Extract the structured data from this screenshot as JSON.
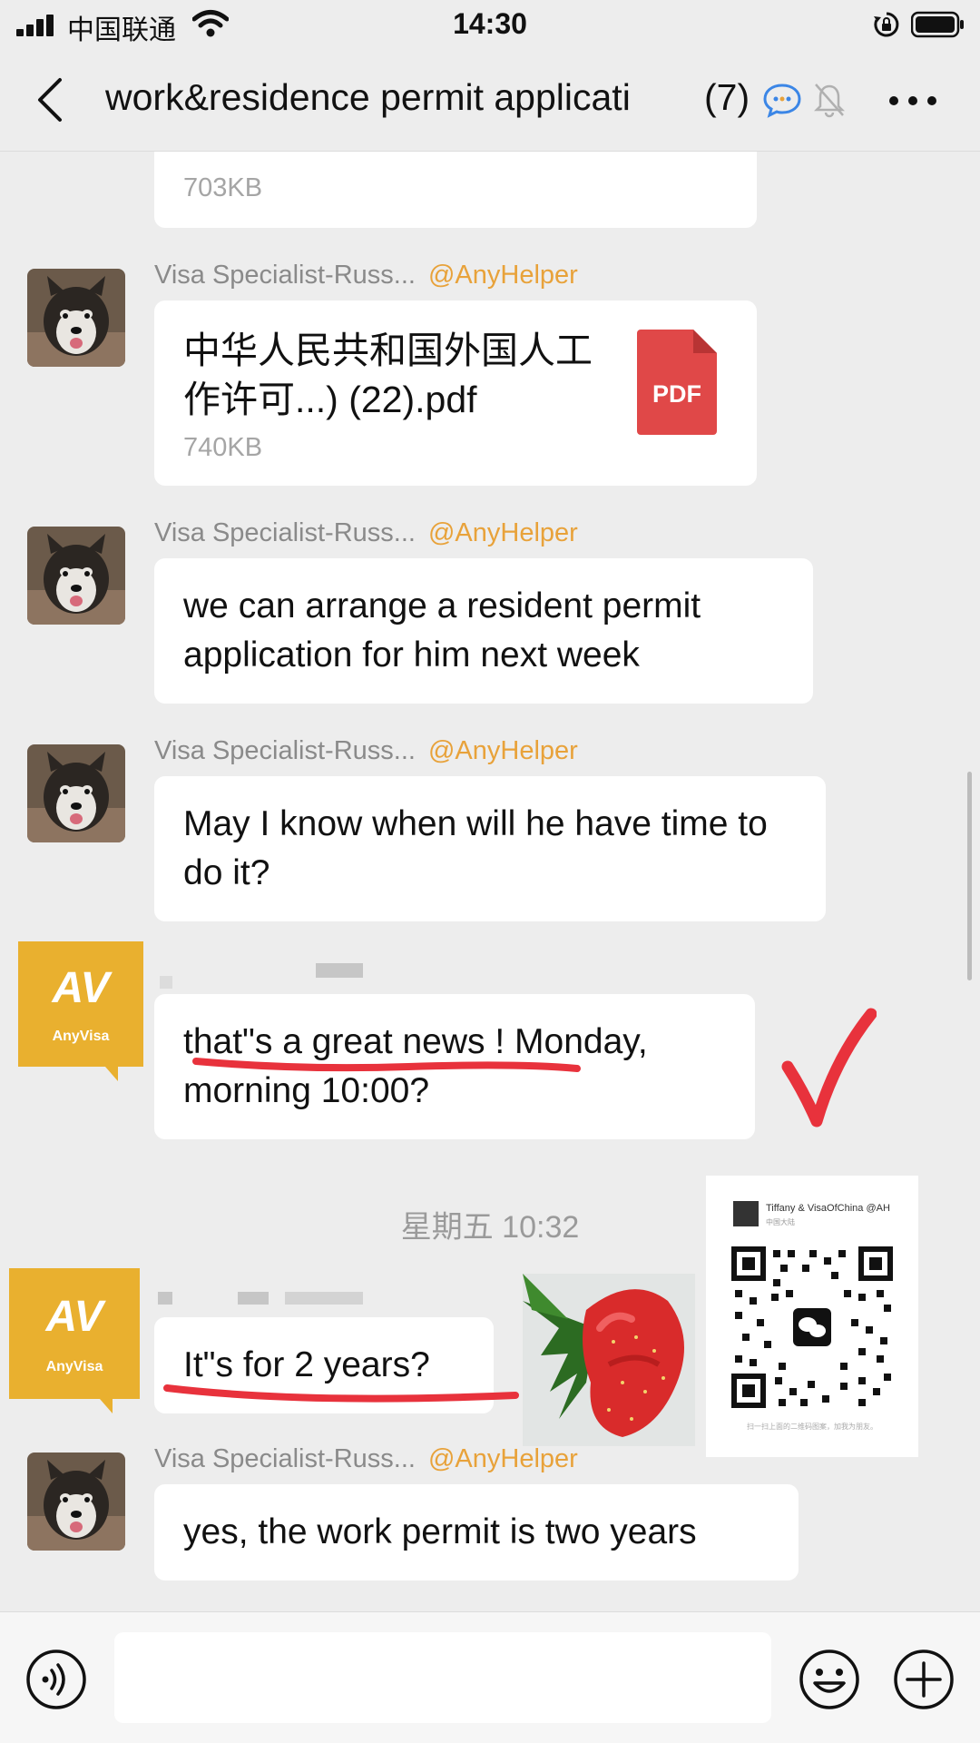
{
  "status_bar": {
    "carrier": "中国联通",
    "time": "14:30"
  },
  "header": {
    "title": "work&residence permit applicati",
    "member_count": "(7)"
  },
  "messages": [
    {
      "type": "file",
      "file_size": "703KB"
    },
    {
      "type": "file",
      "sender": "Visa Specialist-Russ...",
      "mention": "@AnyHelper",
      "file_name": "中华人民共和国外国人工作许可...) (22).pdf",
      "file_size": "740KB",
      "file_type": "PDF"
    },
    {
      "type": "text",
      "sender": "Visa Specialist-Russ...",
      "mention": "@AnyHelper",
      "text": "we can arrange a resident permit application for him next week"
    },
    {
      "type": "text",
      "sender": "Visa Specialist-Russ...",
      "mention": "@AnyHelper",
      "text": "May I know when will he have time to do it?"
    },
    {
      "type": "text",
      "sender_logo": "AnyVisa",
      "text": "that\"s a great news ! Monday, morning 10:00?"
    },
    {
      "type": "timestamp",
      "text": "星期五 10:32"
    },
    {
      "type": "text",
      "sender_logo": "AnyVisa",
      "text": "It\"s for 2 years?"
    },
    {
      "type": "text",
      "sender": "Visa Specialist-Russ...",
      "mention": "@AnyHelper",
      "text": "yes, the work permit is two years"
    }
  ],
  "logo": {
    "mark": "AV",
    "name": "AnyVisa"
  },
  "qr_card": {
    "title": "Tiffany & VisaOfChina @AH",
    "subtitle": "中国大陆",
    "footer": "扫一扫上面的二维码图案，加我为朋友。"
  },
  "input": {
    "placeholder": ""
  },
  "colors": {
    "accent_mention": "#e8a23a",
    "pdf_red": "#e04848",
    "annotation_red": "#e8323c",
    "anyvisa_yellow": "#e9b02f",
    "bubble": "#ffffff",
    "background": "#ededed"
  },
  "icons": {
    "back": "chevron-left-icon",
    "group_chat": "group-chat-icon",
    "mute": "bell-mute-icon",
    "more": "more-dots-icon",
    "voice": "voice-icon",
    "emoji": "emoji-icon",
    "plus": "plus-icon"
  }
}
